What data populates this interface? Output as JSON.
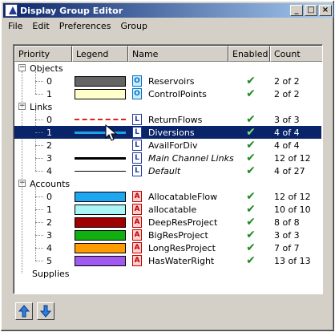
{
  "window": {
    "title": "Display Group Editor"
  },
  "titlebar_buttons": {
    "minimize": "_",
    "maximize": "□",
    "close": "×"
  },
  "menu": [
    "File",
    "Edit",
    "Preferences",
    "Group"
  ],
  "columns": [
    "Priority",
    "Legend",
    "Name",
    "Enabled",
    "Count"
  ],
  "groups": {
    "objects": "Objects",
    "links": "Links",
    "accounts": "Accounts",
    "supplies": "Supplies"
  },
  "objects": [
    {
      "priority": "0",
      "name": "Reservoirs",
      "count": "2 of 2",
      "legend_color": "#646464"
    },
    {
      "priority": "1",
      "name": "ControlPoints",
      "count": "2 of 2",
      "legend_color": "#ffffcc"
    }
  ],
  "links": [
    {
      "priority": "0",
      "name": "ReturnFlows",
      "count": "3 of 3",
      "legend_style": "dashed",
      "legend_color": "#e02020"
    },
    {
      "priority": "1",
      "name": "Diversions",
      "count": "4 of 4",
      "legend_style": "solid-thick",
      "legend_color": "#1fa0e8",
      "selected": true
    },
    {
      "priority": "2",
      "name": "AvailForDiv",
      "count": "4 of 4",
      "legend_style": "none",
      "legend_color": "#ffffff"
    },
    {
      "priority": "3",
      "name": "Main Channel Links",
      "count": "12 of 12",
      "legend_style": "solid-thick",
      "legend_color": "#000000",
      "italic": true
    },
    {
      "priority": "4",
      "name": "Default",
      "count": "4 of 27",
      "legend_style": "solid-thin",
      "legend_color": "#000000",
      "italic": true
    }
  ],
  "accounts": [
    {
      "priority": "0",
      "name": "AllocatableFlow",
      "count": "12 of 12",
      "legend_color": "#1ea6f0"
    },
    {
      "priority": "1",
      "name": "allocatable",
      "count": "10 of 10",
      "legend_color": "#aaf5f5"
    },
    {
      "priority": "2",
      "name": "DeepResProject",
      "count": "8 of 8",
      "legend_color": "#a00000"
    },
    {
      "priority": "3",
      "name": "BigResProject",
      "count": "3 of 3",
      "legend_color": "#10b010"
    },
    {
      "priority": "4",
      "name": "LongResProject",
      "count": "7 of 7",
      "legend_color": "#ff9a00"
    },
    {
      "priority": "5",
      "name": "HasWaterRight",
      "count": "13 of 13",
      "legend_color": "#a05af0"
    }
  ],
  "icons": {
    "object": "object-doc-icon",
    "link": "link-doc-icon",
    "account": "account-doc-icon",
    "enabled": "checkmark-icon",
    "up": "arrow-up-icon",
    "down": "arrow-down-icon"
  },
  "colors": {
    "selection": "#0a246a",
    "check": "#1f8a1f"
  }
}
